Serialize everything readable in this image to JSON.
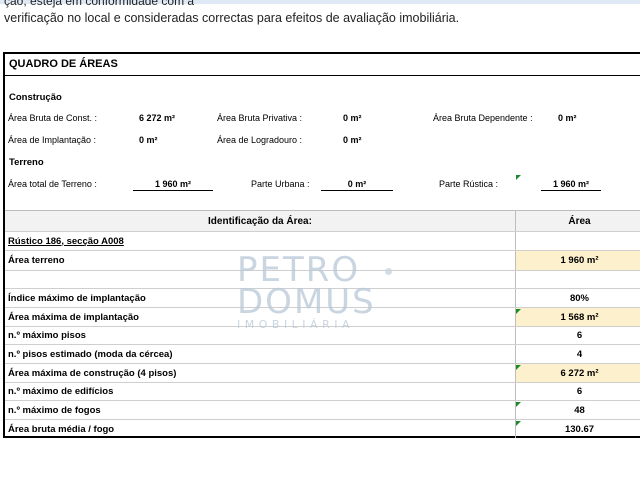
{
  "intro": {
    "cut_line": "ção,                                           esteja em conformidade com a",
    "line": "verificação no local e consideradas correctas para efeitos de avaliação imobiliária."
  },
  "sheet": {
    "title": "QUADRO DE ÁREAS",
    "construcao": {
      "label": "Construção",
      "area_bruta_const_label": "Área Bruta de Const. :",
      "area_bruta_const_value": "6 272  m²",
      "area_bruta_privativa_label": "Área Bruta Privativa :",
      "area_bruta_privativa_value": "0  m²",
      "area_bruta_dependente_label": "Área Bruta Dependente :",
      "area_bruta_dependente_value": "0  m²",
      "area_implantacao_label": "Área de Implantação :",
      "area_implantacao_value": "0  m²",
      "area_logradouro_label": "Área de Logradouro :",
      "area_logradouro_value": "0  m²"
    },
    "terreno": {
      "label": "Terreno",
      "area_total_label": "Área total de Terreno :",
      "area_total_value": "1 960  m²",
      "parte_urbana_label": "Parte Urbana :",
      "parte_urbana_value": "0  m²",
      "parte_rustica_label": "Parte Rústica :",
      "parte_rustica_value": "1 960  m²"
    },
    "table": {
      "col_id": "Identificação da Área:",
      "col_area": "Área",
      "rows": [
        {
          "label": "Rústico 186, secção A008",
          "value": ""
        },
        {
          "label": "Área terreno",
          "value": "1 960  m²"
        },
        {
          "label": "",
          "value": ""
        },
        {
          "label": "Índice máximo de implantação",
          "value": "80%"
        },
        {
          "label": "Área máxima de implantação",
          "value": "1 568  m²"
        },
        {
          "label": "n.º máximo pisos",
          "value": "6"
        },
        {
          "label": "n.º pisos estimado (moda da cércea)",
          "value": "4"
        },
        {
          "label": "Área máxima de construção (4 pisos)",
          "value": "6 272  m²"
        },
        {
          "label": "n.º máximo de edifícios",
          "value": "6"
        },
        {
          "label": "n.º máximo de fogos",
          "value": "48"
        },
        {
          "label": "Área bruta média / fogo",
          "value": "130.67"
        }
      ]
    }
  },
  "watermark": {
    "line1": "PETRO",
    "line2": "DOMUS",
    "line3": "IMOBILIÁRIA"
  },
  "colors": {
    "highlight": "#fdf0cc",
    "marker": "#1a8a2c",
    "watermark": "#b7c8d6"
  }
}
